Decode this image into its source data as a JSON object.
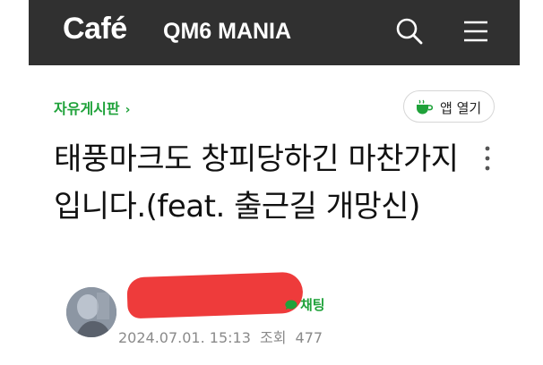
{
  "header": {
    "logo": "Café",
    "cafe_name": "QM6 MANIA",
    "search_icon": "search-icon",
    "menu_icon": "hamburger-menu-icon"
  },
  "board": {
    "name": "자유게시판",
    "chevron": "›"
  },
  "app_button": {
    "label": "앱 열기",
    "icon": "cup-icon"
  },
  "post": {
    "title": "태풍마크도 창피당하긴 마찬가지입니다.(feat. 출근길 개망신)",
    "more_icon": "more-vertical-icon"
  },
  "author": {
    "chat_label": "채팅",
    "date": "2024.07.01. 15:13",
    "views_label": "조회",
    "views": "477"
  },
  "colors": {
    "topbar": "#303030",
    "accent_green": "#1fa23a",
    "redaction": "#ee3b3b"
  }
}
